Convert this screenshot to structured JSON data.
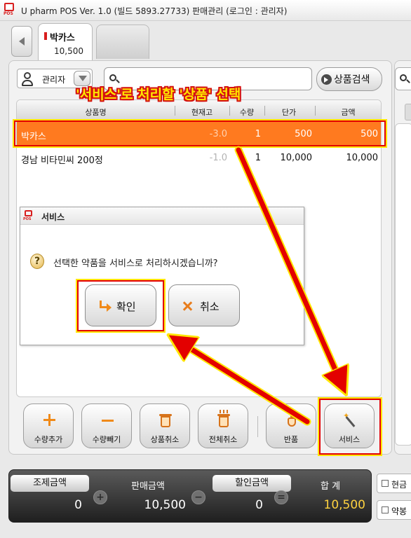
{
  "window": {
    "title": "U pharm POS Ver. 1.0 (빌드 5893.27733) 판매관리 (로그인 : 관리자)",
    "logo_text": "POS"
  },
  "tabs": [
    {
      "name": "박카스",
      "amount": "10,500",
      "active": true
    }
  ],
  "user": {
    "label": "관리자"
  },
  "search": {
    "prefix": "Q:",
    "button_label": "상품검색"
  },
  "table": {
    "columns": [
      "상품명",
      "현재고",
      "수량",
      "단가",
      "금액"
    ],
    "rows": [
      {
        "name": "박카스",
        "stock": "-3.0",
        "qty": "1",
        "price": "500",
        "amount": "500",
        "selected": true
      },
      {
        "name": "경남 비타민씨 200정",
        "stock": "-1.0",
        "qty": "1",
        "price": "10,000",
        "amount": "10,000",
        "selected": false
      }
    ]
  },
  "dialog": {
    "title": "서비스",
    "logo_text": "POS",
    "message": "선택한 약품을 서비스로 처리하시겠습니까?",
    "confirm_label": "확인",
    "cancel_label": "취소"
  },
  "toolbar": [
    {
      "label": "수량추가",
      "icon": "plus-icon"
    },
    {
      "label": "수량빼기",
      "icon": "minus-icon"
    },
    {
      "label": "상품취소",
      "icon": "trash-icon"
    },
    {
      "label": "전체취소",
      "icon": "trash-all-icon"
    },
    {
      "label": "반품",
      "icon": "hand-icon"
    },
    {
      "label": "서비스",
      "icon": "magic-wand-icon"
    }
  ],
  "totals": {
    "prep_label": "조제금액",
    "prep_value": "0",
    "sale_label": "판매금액",
    "sale_value": "10,500",
    "discount_label": "할인금액",
    "discount_value": "0",
    "total_label": "합 계",
    "total_value": "10,500"
  },
  "right_options": [
    "현금",
    "약봉"
  ],
  "annotation": {
    "text": "'서비스'로 처리할 '상품' 선택",
    "color_text": "#ffe600",
    "color_outline": "#d41111"
  },
  "colors": {
    "selected_row": "#ff7a1f",
    "accent": "#f08a19",
    "total_value": "#ffd23f"
  }
}
